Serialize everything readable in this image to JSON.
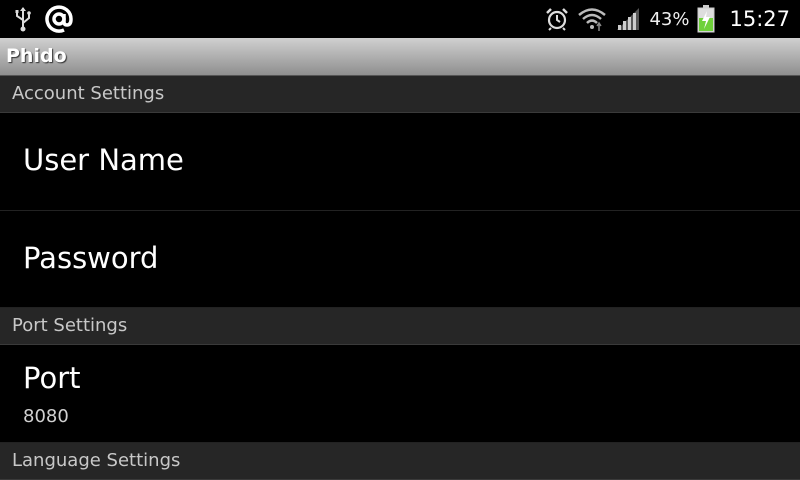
{
  "status_bar": {
    "left_icons": [
      "usb-icon",
      "at-sign-icon"
    ],
    "right_icons": [
      "alarm-icon",
      "wifi-icon",
      "signal-icon",
      "battery-charging-icon"
    ],
    "battery_percent": "43%",
    "time": "15:27"
  },
  "app": {
    "title": "Phido"
  },
  "sections": {
    "account": {
      "header": "Account Settings",
      "user_name": {
        "title": "User Name"
      },
      "password": {
        "title": "Password"
      }
    },
    "port": {
      "header": "Port Settings",
      "port": {
        "title": "Port",
        "summary": "8080"
      }
    },
    "language": {
      "header": "Language Settings"
    }
  },
  "colors": {
    "background": "#000000",
    "section_header_bg": "#262626",
    "battery_charge": "#6fd13a"
  }
}
